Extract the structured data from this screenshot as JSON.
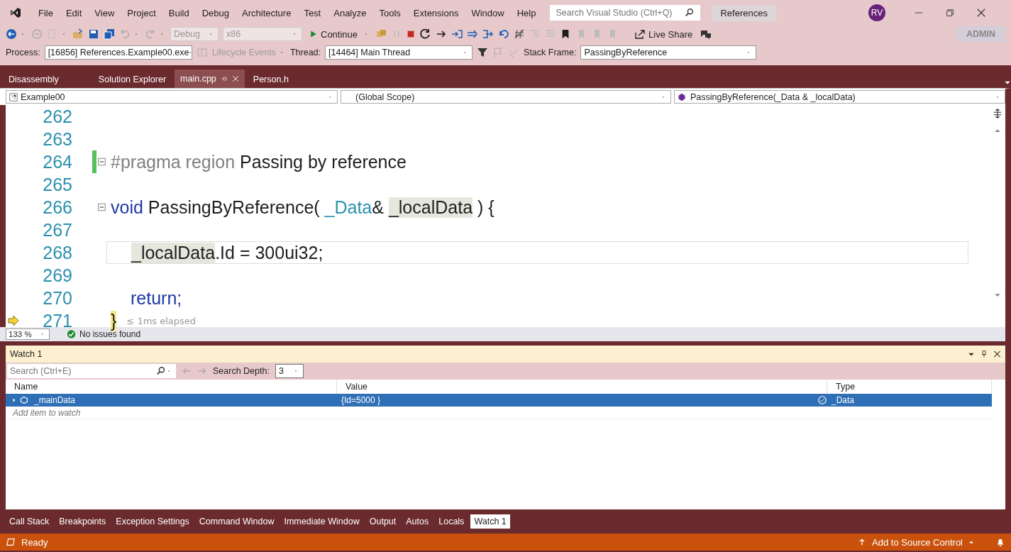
{
  "menu": {
    "items": [
      "File",
      "Edit",
      "View",
      "Project",
      "Build",
      "Debug",
      "Architecture",
      "Test",
      "Analyze",
      "Tools",
      "Extensions",
      "Window",
      "Help"
    ],
    "search_placeholder": "Search Visual Studio (Ctrl+Q)",
    "solution": "References",
    "avatar": "RV"
  },
  "toolbar": {
    "configuration": "Debug",
    "platform": "x86",
    "continue": "Continue",
    "live_share": "Live Share",
    "admin": "ADMIN"
  },
  "debug_location": {
    "process_label": "Process:",
    "process": "[16856] References.Example00.exe",
    "lifecycle": "Lifecycle Events",
    "thread_label": "Thread:",
    "thread": "[14464] Main Thread",
    "stack_frame_label": "Stack Frame:",
    "stack_frame": "PassingByReference"
  },
  "doc_tabs": [
    {
      "label": "Disassembly",
      "selected": false
    },
    {
      "label": "Solution Explorer",
      "selected": false
    },
    {
      "label": "main.cpp",
      "selected": true
    },
    {
      "label": "Person.h",
      "selected": false
    }
  ],
  "nav_bar": {
    "project": "Example00",
    "scope": "(Global Scope)",
    "member": "PassingByReference(_Data & _localData)"
  },
  "editor": {
    "lines": [
      {
        "number": "262",
        "fold": false,
        "changed": false,
        "caret_line": false,
        "current": false
      },
      {
        "number": "263",
        "fold": false,
        "changed": false,
        "caret_line": false,
        "current": false
      },
      {
        "number": "264",
        "tokens": [
          {
            "text": "#pragma region",
            "kind": "preprocessor"
          },
          {
            "text": " Passing by reference",
            "kind": "plain"
          }
        ],
        "fold": true,
        "changed": true,
        "caret_line": false,
        "current": false
      },
      {
        "number": "265",
        "fold": false,
        "changed": false,
        "caret_line": false,
        "current": false
      },
      {
        "number": "266",
        "tokens": [
          {
            "text": "void",
            "kind": "keyword"
          },
          {
            "text": " PassingByReference( ",
            "kind": "plain"
          },
          {
            "text": "_Data",
            "kind": "type"
          },
          {
            "text": "& ",
            "kind": "plain"
          },
          {
            "text": "_localData",
            "kind": "reference"
          },
          {
            "text": " ) {",
            "kind": "plain"
          }
        ],
        "fold": true,
        "changed": false,
        "caret_line": false,
        "current": false
      },
      {
        "number": "267",
        "fold": false,
        "changed": false,
        "caret_line": false,
        "current": false
      },
      {
        "number": "268",
        "tokens": [
          {
            "text": "_localData",
            "kind": "reference"
          },
          {
            "text": ".Id = 300ui32;",
            "kind": "plain"
          }
        ],
        "fold": false,
        "changed": false,
        "caret_line": true,
        "current": false
      },
      {
        "number": "269",
        "fold": false,
        "changed": false,
        "caret_line": false,
        "current": false
      },
      {
        "number": "270",
        "tokens": [
          {
            "text": "return;",
            "kind": "keyword"
          }
        ],
        "fold": false,
        "changed": false,
        "caret_line": false,
        "current": false
      },
      {
        "number": "271",
        "tokens": [
          {
            "text": "}",
            "kind": "brace"
          },
          {
            "text": "≤ 1ms elapsed",
            "kind": "hint"
          }
        ],
        "fold": false,
        "changed": false,
        "caret_line": false,
        "current": true
      }
    ],
    "zoom": "133 %",
    "issues": "No issues found"
  },
  "watch": {
    "title": "Watch 1",
    "search_placeholder": "Search (Ctrl+E)",
    "depth_label": "Search Depth:",
    "depth": "3",
    "columns": [
      "Name",
      "Value",
      "Type"
    ],
    "rows": [
      {
        "name": "_mainData",
        "value": "{Id=5000 }",
        "type": "_Data",
        "selected": true
      }
    ],
    "add_placeholder": "Add item to watch"
  },
  "tool_tabs": [
    {
      "label": "Call Stack",
      "selected": false
    },
    {
      "label": "Breakpoints",
      "selected": false
    },
    {
      "label": "Exception Settings",
      "selected": false
    },
    {
      "label": "Command Window",
      "selected": false
    },
    {
      "label": "Immediate Window",
      "selected": false
    },
    {
      "label": "Output",
      "selected": false
    },
    {
      "label": "Autos",
      "selected": false
    },
    {
      "label": "Locals",
      "selected": false
    },
    {
      "label": "Watch 1",
      "selected": true
    }
  ],
  "status_bar": {
    "state": "Ready",
    "source_control": "Add to Source Control"
  }
}
